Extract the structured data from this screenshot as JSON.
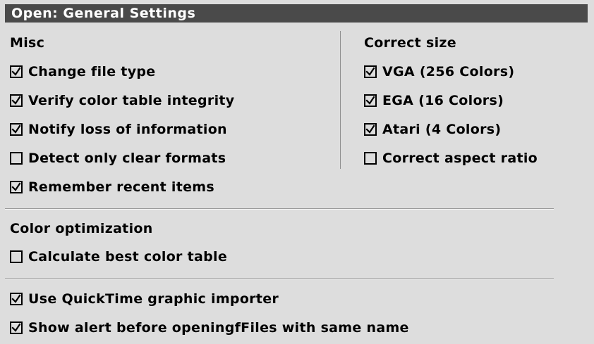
{
  "dialog": {
    "title": "Open: General Settings"
  },
  "misc": {
    "header": "Misc",
    "items": [
      {
        "label": "Change file type",
        "checked": true
      },
      {
        "label": "Verify color table integrity",
        "checked": true
      },
      {
        "label": "Notify loss of information",
        "checked": true
      },
      {
        "label": "Detect only clear formats",
        "checked": false
      },
      {
        "label": "Remember recent items",
        "checked": true
      }
    ]
  },
  "correct_size": {
    "header": "Correct size",
    "items": [
      {
        "label": "VGA (256 Colors)",
        "checked": true
      },
      {
        "label": "EGA (16 Colors)",
        "checked": true
      },
      {
        "label": "Atari (4 Colors)",
        "checked": true
      },
      {
        "label": "Correct aspect ratio",
        "checked": false
      }
    ]
  },
  "color_optimization": {
    "header": "Color optimization",
    "items": [
      {
        "label": "Calculate best color table",
        "checked": false
      }
    ]
  },
  "other": {
    "items": [
      {
        "label": "Use QuickTime graphic importer",
        "checked": true
      },
      {
        "label": "Show alert before openingfFiles with same name",
        "checked": true
      }
    ]
  },
  "colors": {
    "panel_bg": "#dddddd",
    "title_bg": "#4a4a4a",
    "title_fg": "#ffffff",
    "text": "#000000"
  }
}
